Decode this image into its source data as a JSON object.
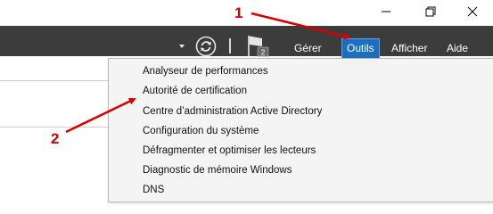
{
  "window_controls": {
    "minimize_icon": "minimize-icon",
    "maximize_icon": "restore-icon",
    "close_icon": "close-icon"
  },
  "toolbar": {
    "refresh_icon": "refresh-icon",
    "notifications_icon": "flag-icon",
    "notifications_badge": "2"
  },
  "menubar": {
    "items": [
      "Gérer",
      "Outils",
      "Afficher",
      "Aide"
    ],
    "active": "Outils",
    "active_color": "#1a6fc4"
  },
  "tools_menu": {
    "items": [
      "Analyseur de performances",
      "Autorité de certification",
      "Centre d’administration Active Directory",
      "Configuration du système",
      "Défragmenter et optimiser les lecteurs",
      "Diagnostic de mémoire Windows",
      "DNS"
    ]
  },
  "annotations": {
    "labels": [
      "1",
      "2"
    ],
    "color": "#d40000"
  }
}
